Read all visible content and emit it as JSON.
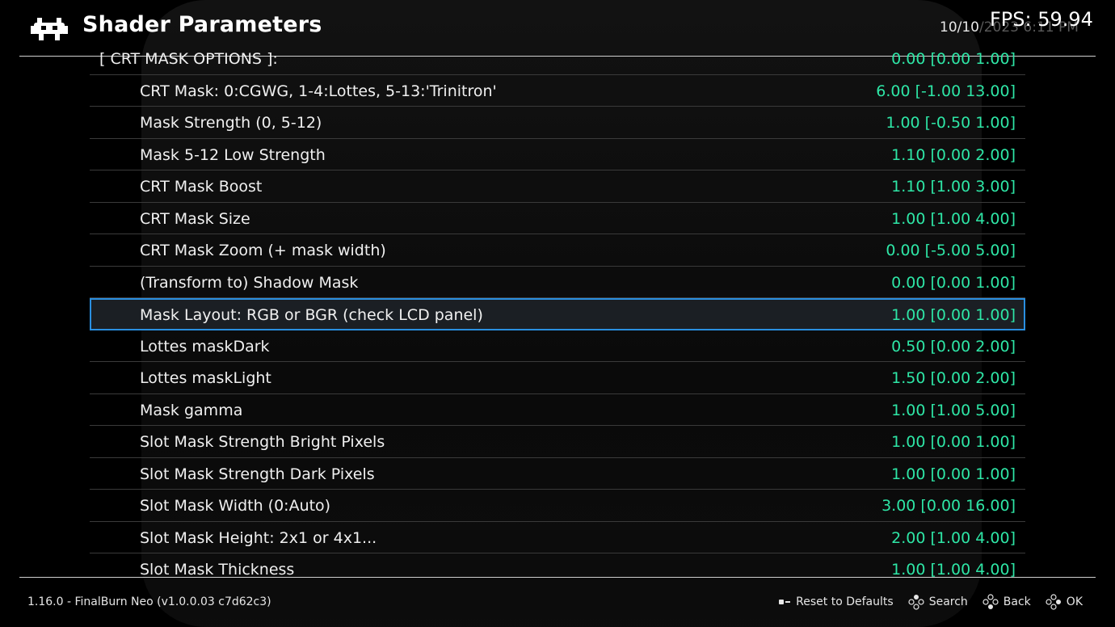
{
  "header": {
    "title": "Shader Parameters",
    "clock_visible": "10/10",
    "clock_faded": "/2023 6:11 PM",
    "fps": "FPS:  59.94"
  },
  "rows": [
    {
      "label": "[ CRT MASK OPTIONS ]:",
      "value": "0.00 [0.00 1.00]"
    },
    {
      "label": "CRT Mask: 0:CGWG, 1-4:Lottes, 5-13:'Trinitron'",
      "value": "6.00 [-1.00 13.00]"
    },
    {
      "label": "Mask Strength (0, 5-12)",
      "value": "1.00 [-0.50 1.00]"
    },
    {
      "label": "Mask 5-12 Low Strength",
      "value": "1.10 [0.00 2.00]"
    },
    {
      "label": "CRT Mask Boost",
      "value": "1.10 [1.00 3.00]"
    },
    {
      "label": "CRT Mask Size",
      "value": "1.00 [1.00 4.00]"
    },
    {
      "label": "CRT Mask Zoom (+ mask width)",
      "value": "0.00 [-5.00 5.00]"
    },
    {
      "label": "(Transform to) Shadow Mask",
      "value": "0.00 [0.00 1.00]"
    },
    {
      "label": "Mask Layout: RGB or BGR (check LCD panel)",
      "value": "1.00 [0.00 1.00]"
    },
    {
      "label": "Lottes maskDark",
      "value": "0.50 [0.00 2.00]"
    },
    {
      "label": "Lottes maskLight",
      "value": "1.50 [0.00 2.00]"
    },
    {
      "label": "Mask gamma",
      "value": "1.00 [1.00 5.00]"
    },
    {
      "label": "Slot Mask Strength Bright Pixels",
      "value": "1.00 [0.00 1.00]"
    },
    {
      "label": "Slot Mask Strength Dark Pixels",
      "value": "1.00 [0.00 1.00]"
    },
    {
      "label": "Slot Mask Width (0:Auto)",
      "value": "3.00 [0.00 16.00]"
    },
    {
      "label": "Slot Mask Height: 2x1 or 4x1...",
      "value": "2.00 [1.00 4.00]"
    },
    {
      "label": "Slot Mask Thickness",
      "value": "1.00 [1.00 4.00]"
    }
  ],
  "footer": {
    "version": "1.16.0 - FinalBurn Neo (v1.0.0.03  c7d62c3)",
    "actions": {
      "reset": "Reset to Defaults",
      "search": "Search",
      "back": "Back",
      "ok": "OK"
    }
  },
  "colors": {
    "value": "#2ee6a6",
    "selection_border": "#2a8fe0",
    "background": "#000000"
  }
}
